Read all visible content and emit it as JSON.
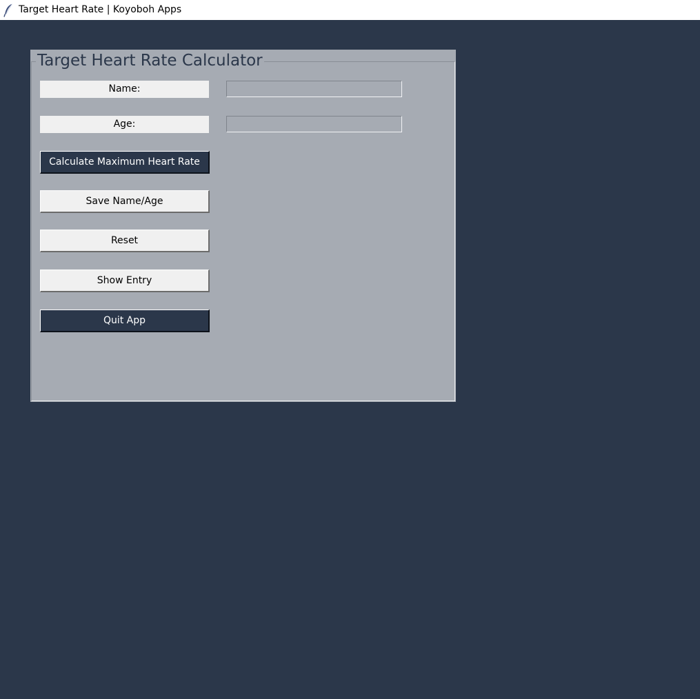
{
  "window": {
    "title": "Target Heart Rate | Koyoboh Apps",
    "icon": "feather-icon"
  },
  "panel": {
    "title": "Target Heart Rate Calculator"
  },
  "form": {
    "name_label": "Name:",
    "name_value": "",
    "age_label": "Age:",
    "age_value": ""
  },
  "buttons": {
    "calculate": "Calculate Maximum Heart Rate",
    "save": "Save Name/Age",
    "reset": "Reset",
    "show_entry": "Show Entry",
    "quit": "Quit App"
  },
  "colors": {
    "background": "#2b374a",
    "panel": "#a6abb3",
    "panel_title": "#2b374a",
    "button_light": "#f0f0f0",
    "button_dark": "#2b374a"
  }
}
